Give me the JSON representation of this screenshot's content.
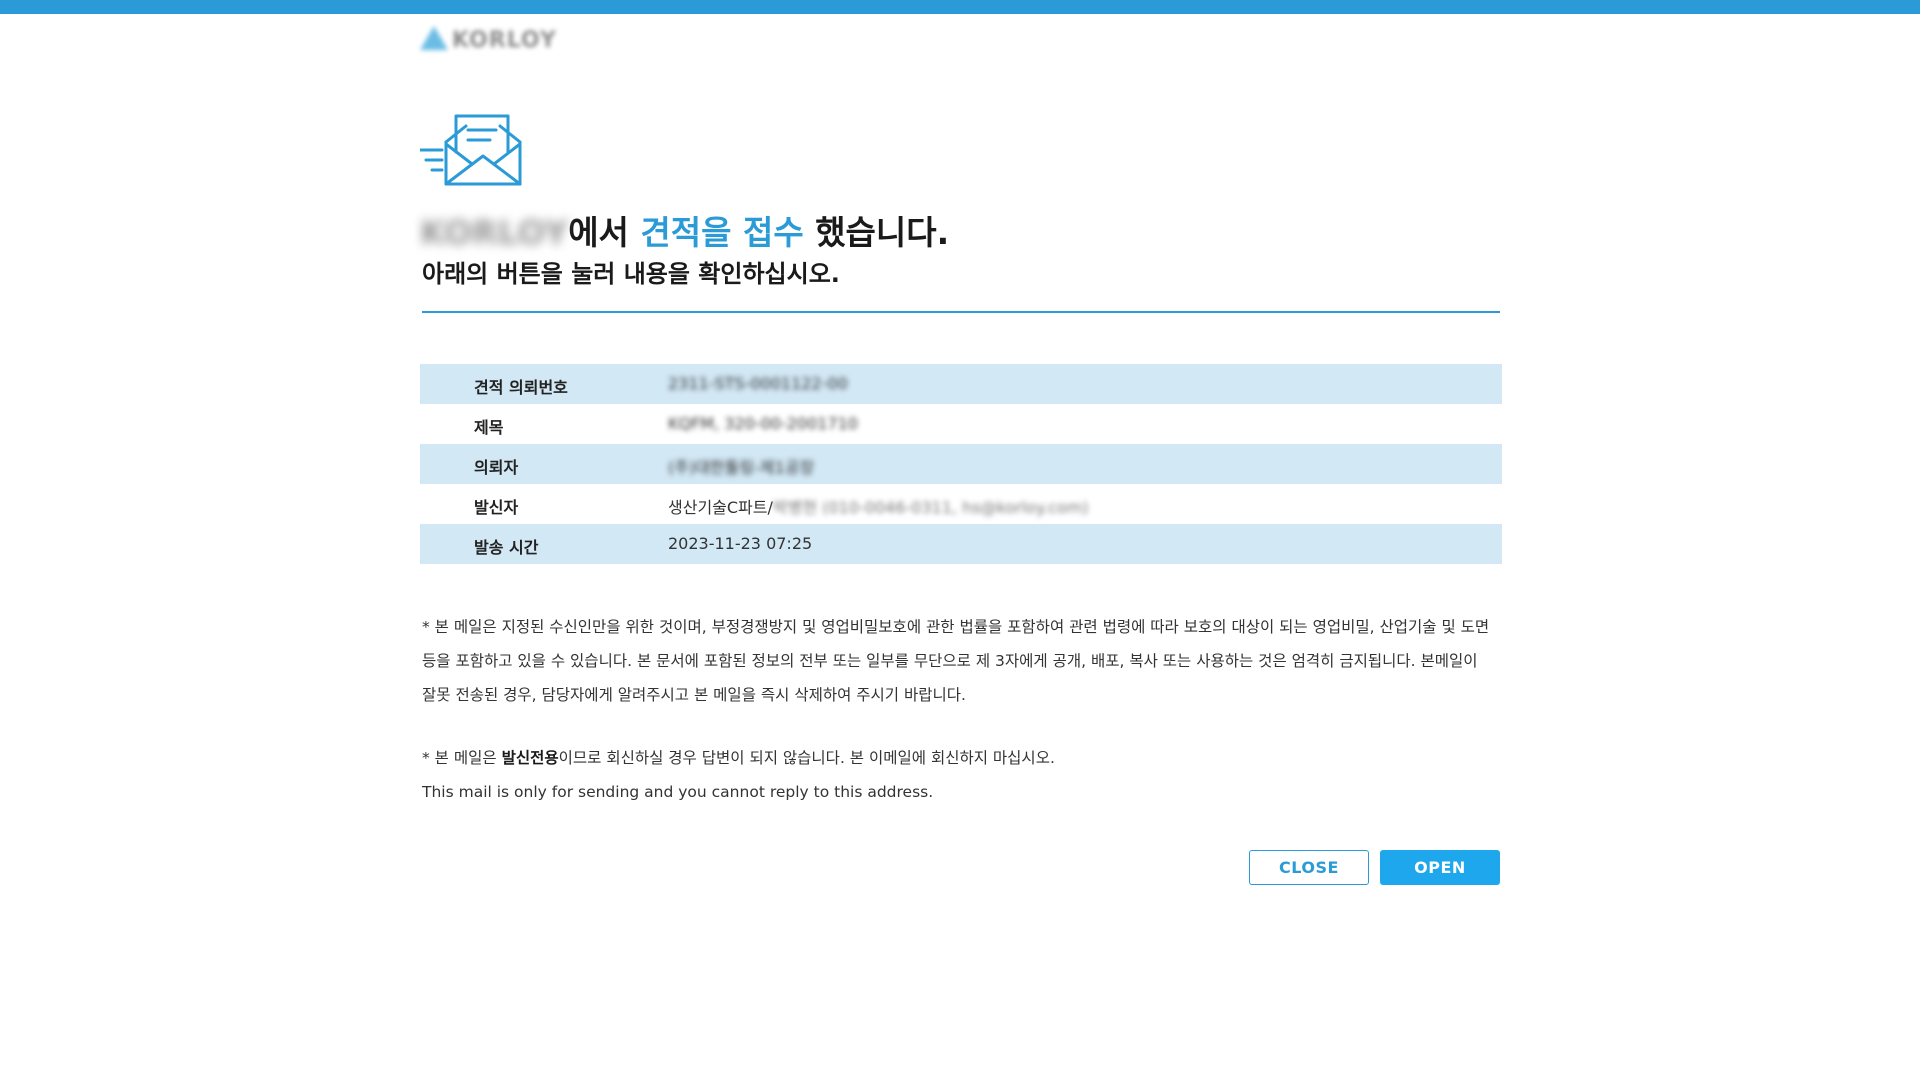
{
  "brand": {
    "logo_text": "KORLOY",
    "color_accent": "#2a9bd6"
  },
  "headline": {
    "company": "KORLOY",
    "part1": "에서 ",
    "highlight": "견적을 접수",
    "part2": " 했습니다."
  },
  "subhead": "아래의 버튼을 눌러 내용을 확인하십시오.",
  "info_rows": [
    {
      "label": "견적 의뢰번호",
      "value": "2311-STS-0001122-00"
    },
    {
      "label": "제목",
      "value": "KQFM, 320-00-2001710"
    },
    {
      "label": "의뢰자",
      "value": "(주)대한툴링-제1공장"
    },
    {
      "label": "발신자",
      "value": "생산기술C파트/",
      "value_hidden": "박병현 (010-0046-0311, hs@korloy.com)"
    },
    {
      "label": "발송 시간",
      "value": "2023-11-23 07:25"
    }
  ],
  "notice": {
    "line1": "* 본 메일은 지정된 수신인만을 위한 것이며, 부정경쟁방지 및 영업비밀보호에 관한 법률을 포함하여 관련 법령에 따라 보호의 대상이 되는 영업비밀, 산업기술 및 도면",
    "line2": "등을 포함하고 있을 수 있습니다. 본 문서에 포함된 정보의 전부 또는 일부를 무단으로 제 3자에게 공개, 배포, 복사 또는 사용하는 것은 엄격히 금지됩니다. 본메일이",
    "line3": "잘못 전송된 경우, 담당자에게 알려주시고 본 메일을 즉시 삭제하여 주시기 바랍니다.",
    "line4_prefix": "* 본 메일은 ",
    "line4_bold": "발신전용",
    "line4_suffix": "이므로 회신하실 경우 답변이 되지 않습니다. 본 이메일에 회신하지 마십시오.",
    "line5": "This mail is only for sending and you cannot reply to this address."
  },
  "buttons": {
    "close": "CLOSE",
    "open": "OPEN"
  }
}
